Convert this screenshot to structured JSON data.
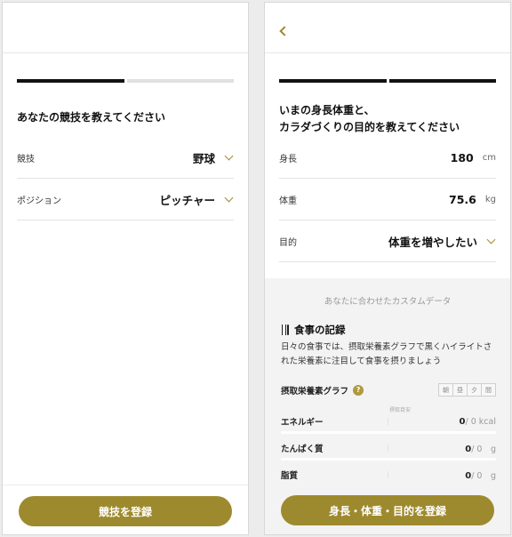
{
  "left": {
    "question": "あなたの競技を教えてください",
    "rows": [
      {
        "label": "競技",
        "value": "野球"
      },
      {
        "label": "ポジション",
        "value": "ピッチャー"
      }
    ],
    "submit_label": "競技を登録",
    "progress": {
      "step": 1,
      "total": 2
    }
  },
  "right": {
    "question_line1": "いまの身長体重と、",
    "question_line2": "カラダづくりの目的を教えてください",
    "height": {
      "label": "身長",
      "value": "180",
      "unit": "cm"
    },
    "weight": {
      "label": "体重",
      "value": "75.6",
      "unit": "kg"
    },
    "purpose": {
      "label": "目的",
      "value": "体重を増やしたい"
    },
    "progress": {
      "step": 2,
      "total": 2
    },
    "custom_caption": "あなたに合わせたカスタムデータ",
    "meal_title": "食事の記録",
    "meal_desc": "日々の食事では、摂取栄養素グラフで黒くハイライトされた栄養素に注目して食事を摂りましょう",
    "graph_title": "摂取栄養素グラフ",
    "help_glyph": "?",
    "meal_tabs": [
      "朝",
      "昼",
      "夕",
      "間"
    ],
    "target_caption": "摂取目安",
    "nutrients": [
      {
        "name": "エネルギー",
        "value": "0",
        "target": "/ 0 kcal"
      },
      {
        "name": "たんぱく質",
        "value": "0",
        "target": "/ 0　g"
      },
      {
        "name": "脂質",
        "value": "0",
        "target": "/ 0　g"
      }
    ],
    "submit_label": "身長・体重・目的を登録"
  },
  "colors": {
    "accent": "#9e8a2e",
    "progress_active": "#111111",
    "progress_inactive": "#e0e0e0"
  }
}
